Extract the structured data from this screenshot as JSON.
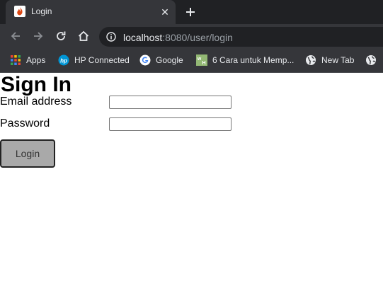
{
  "browser": {
    "tab": {
      "title": "Login",
      "favicon": "codeigniter-flame-icon",
      "favicon_color": "#dd4814"
    },
    "url": {
      "host": "localhost",
      "path": ":8080/user/login"
    },
    "bookmarks": [
      {
        "label": "Apps",
        "icon": "apps-grid-icon"
      },
      {
        "label": "HP Connected",
        "icon": "hp-logo-icon"
      },
      {
        "label": "Google",
        "icon": "google-g-icon"
      },
      {
        "label": "6 Cara untuk Memp...",
        "icon": "wikihow-icon"
      },
      {
        "label": "New Tab",
        "icon": "globe-icon"
      },
      {
        "label": "",
        "icon": "globe-icon"
      }
    ]
  },
  "page": {
    "title": "Sign In",
    "email_label": "Email address",
    "email_value": "",
    "password_label": "Password",
    "password_value": "",
    "login_button": "Login"
  },
  "colors": {
    "chrome_dark": "#202124",
    "chrome_toolbar": "#35363a",
    "button_bg": "#a9a9a9"
  }
}
